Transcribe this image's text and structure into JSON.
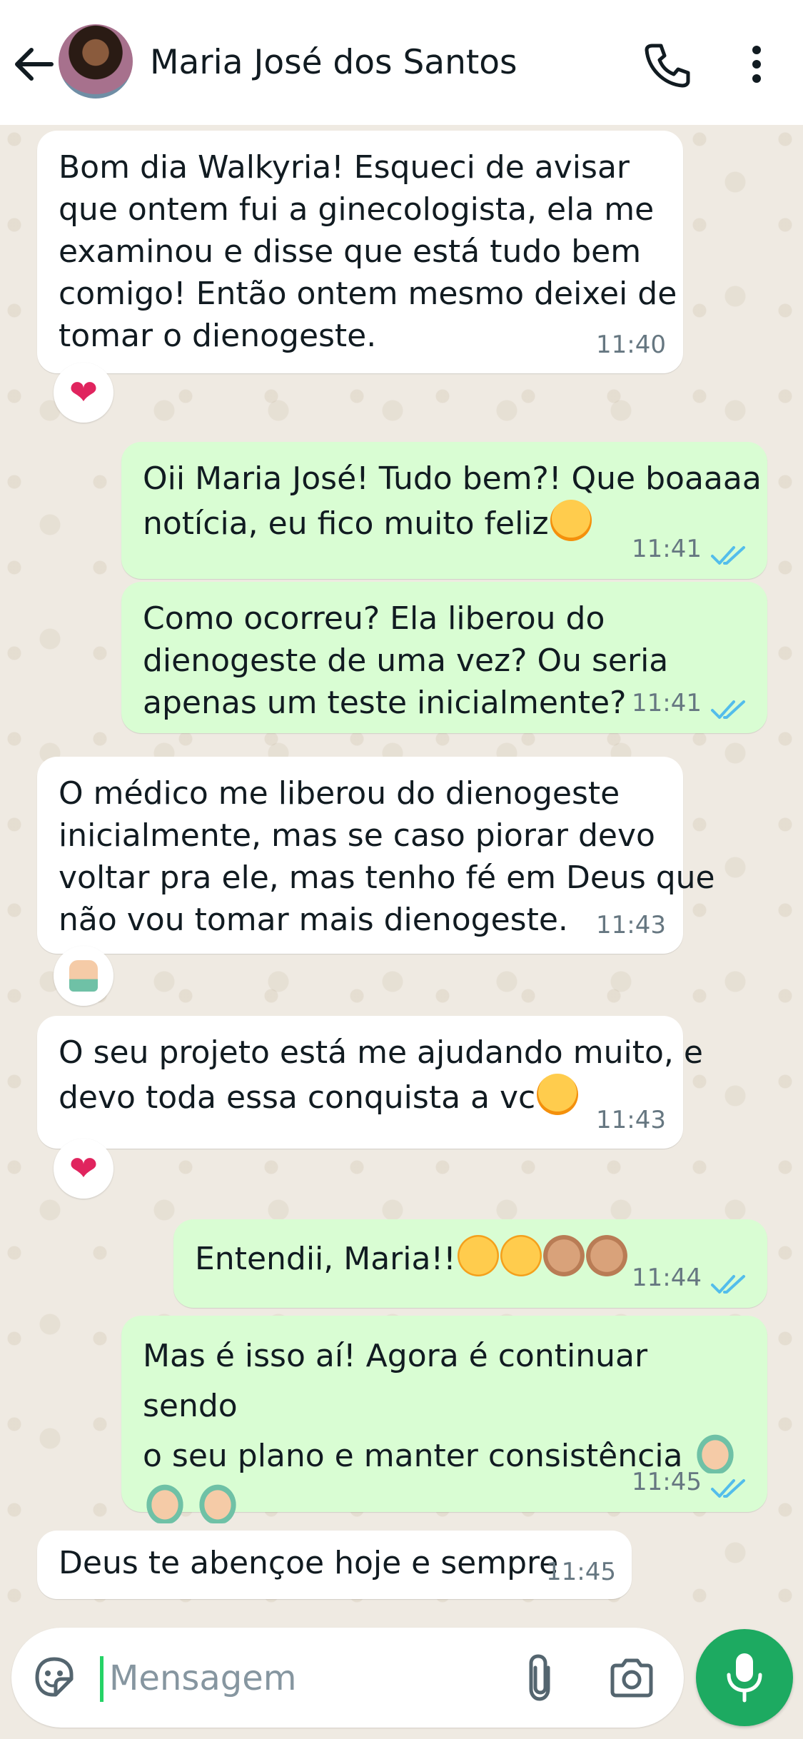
{
  "header": {
    "contact_name": "Maria José dos Santos"
  },
  "messages": [
    {
      "direction": "in",
      "text": "Bom dia Walkyria! Esqueci de avisar\nque ontem fui a ginecologista, ela me\nexaminou e disse que está tudo bem\ncomigo! Então ontem mesmo deixei de\ntomar o dienogeste.",
      "time": "11:40",
      "reaction": "red-heart"
    },
    {
      "direction": "out",
      "text_before_emoji": "Oii Maria José! Tudo bem?! Que boaaaa\nnotícia, eu fico muito feliz",
      "emoji": [
        "smiling-face-with-hearts"
      ],
      "time": "11:41",
      "status": "read"
    },
    {
      "direction": "out",
      "text": "Como ocorreu? Ela liberou do\ndienogeste de uma vez? Ou seria\napenas um teste inicialmente?",
      "time": "11:41",
      "status": "read"
    },
    {
      "direction": "in",
      "text": "O médico me liberou do dienogeste\ninicialmente, mas se caso piorar devo\nvoltar pra ele, mas tenho fé em Deus que\nnão vou tomar mais dienogeste.",
      "time": "11:43",
      "reaction": "folded-hands"
    },
    {
      "direction": "in",
      "text_before_emoji": "O seu projeto está me ajudando muito, e\ndevo toda essa conquista a vc",
      "emoji": [
        "face-blowing-kiss"
      ],
      "time": "11:43",
      "reaction": "red-heart"
    },
    {
      "direction": "out",
      "text_before_emoji": "Entendii, Maria!!",
      "emoji": [
        "star-struck",
        "star-struck",
        "clapping-hands",
        "clapping-hands"
      ],
      "time": "11:44",
      "status": "read"
    },
    {
      "direction": "out",
      "text_before_emoji": "Mas é isso aí! Agora é continuar sendo\no seu plano e manter consistência ",
      "emoji": [
        "folded-hands",
        "folded-hands",
        "folded-hands"
      ],
      "time": "11:45",
      "status": "read"
    },
    {
      "direction": "in",
      "text": "Deus te abençoe hoje e sempre",
      "time": "11:45"
    }
  ],
  "reaction_glyphs": {
    "red-heart": "❤"
  },
  "composer": {
    "placeholder": "Mensagem"
  },
  "colors": {
    "chat_bg": "#efeae2",
    "incoming_bubble": "#ffffff",
    "outgoing_bubble": "#d9fdd3",
    "read_ticks": "#53bdeb",
    "mic_button": "#1daa61"
  }
}
